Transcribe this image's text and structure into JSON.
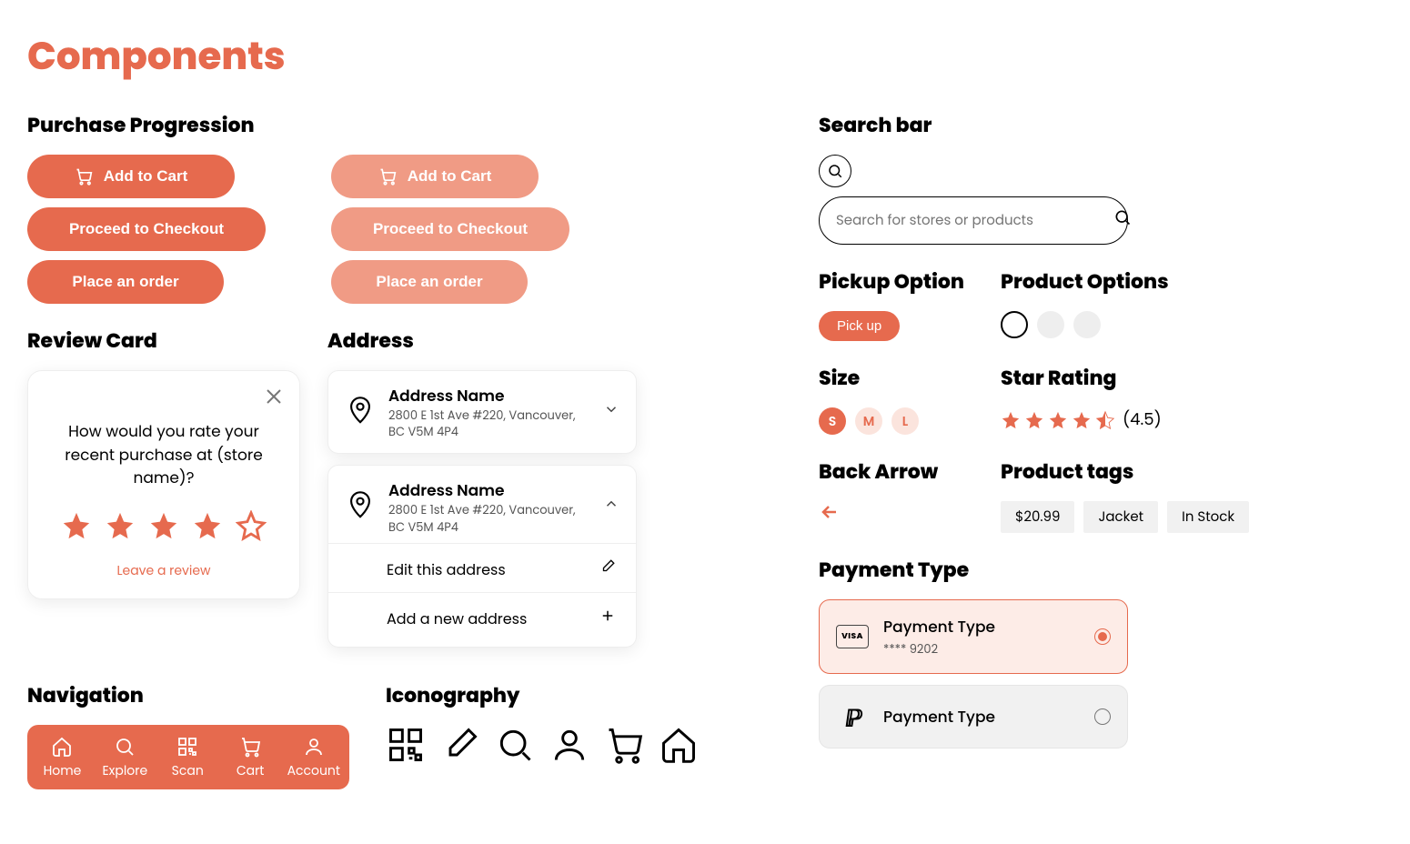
{
  "title": "Components",
  "sections": {
    "purchase": "Purchase Progression",
    "review": "Review Card",
    "address": "Address",
    "navigation": "Navigation",
    "iconography": "Iconography",
    "searchbar": "Search bar",
    "pickup": "Pickup Option",
    "productOptions": "Product Options",
    "size": "Size",
    "starRating": "Star Rating",
    "backArrow": "Back Arrow",
    "productTags": "Product tags",
    "paymentType": "Payment Type"
  },
  "buttons": {
    "addToCart": "Add to Cart",
    "proceed": "Proceed to Checkout",
    "placeOrder": "Place an order"
  },
  "review": {
    "question": "How would you rate your recent purchase at (store name)?",
    "leave": "Leave a review",
    "filledStars": 4,
    "totalStars": 5
  },
  "address": {
    "name": "Address Name",
    "line": "2800 E 1st Ave #220, Vancouver, BC V5M 4P4",
    "edit": "Edit this address",
    "add": "Add a new address"
  },
  "nav": {
    "items": [
      "Home",
      "Explore",
      "Scan",
      "Cart",
      "Account"
    ]
  },
  "search": {
    "placeholder": "Search for stores or products"
  },
  "pickup": {
    "label": "Pick up"
  },
  "sizes": [
    "S",
    "M",
    "L"
  ],
  "rating": {
    "value": "(4.5)"
  },
  "tags": [
    "$20.99",
    "Jacket",
    "In Stock"
  ],
  "payment": {
    "title": "Payment Type",
    "cardLast4": "**** 9202",
    "visa": "VISA"
  },
  "colors": {
    "accent": "#e66a4e",
    "accentLight": "#f09b85"
  }
}
